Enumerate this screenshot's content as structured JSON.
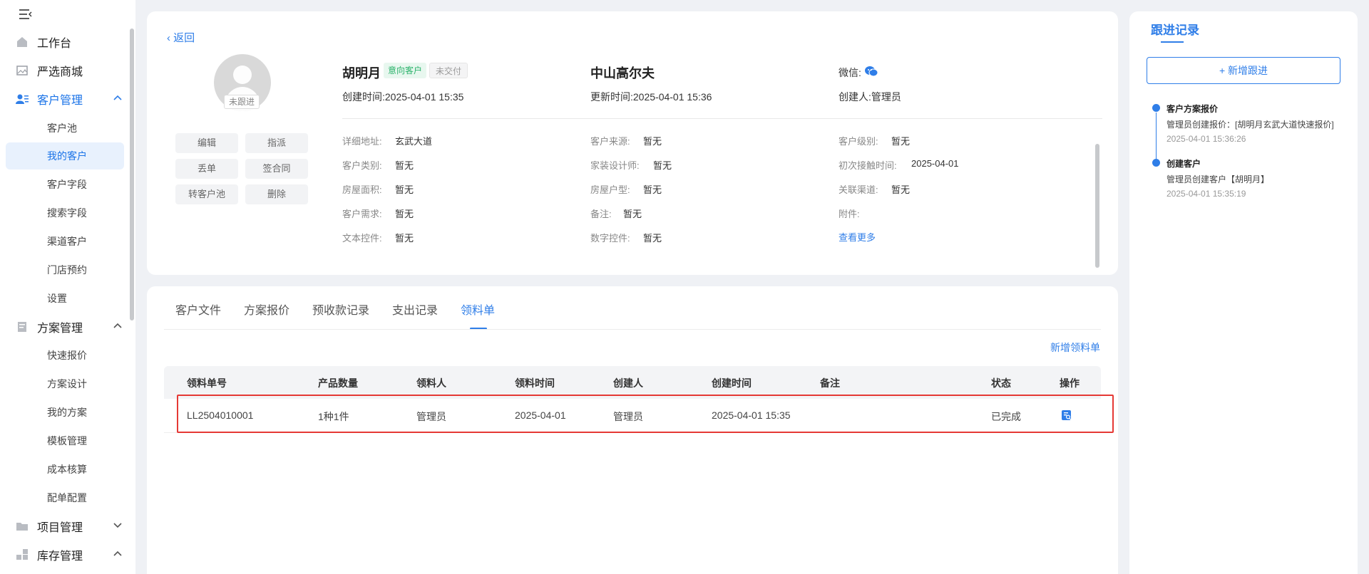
{
  "sidebar": {
    "menu": [
      {
        "label": "工作台",
        "icon": "home-icon"
      },
      {
        "label": "严选商城",
        "icon": "image-icon"
      },
      {
        "label": "客户管理",
        "icon": "user-card-icon"
      },
      {
        "label": "方案管理",
        "icon": "document-icon"
      },
      {
        "label": "项目管理",
        "icon": "folder-icon"
      },
      {
        "label": "库存管理",
        "icon": "grid-icon"
      }
    ],
    "customer_sub": [
      "客户池",
      "我的客户",
      "客户字段",
      "搜索字段",
      "渠道客户",
      "门店预约",
      "设置"
    ],
    "plan_sub": [
      "快速报价",
      "方案设计",
      "我的方案",
      "模板管理",
      "成本核算",
      "配单配置"
    ]
  },
  "header": {
    "back": "返回",
    "avatar_tag": "未跟进",
    "actions": [
      "编辑",
      "指派",
      "丢单",
      "签合同",
      "转客户池",
      "删除"
    ],
    "name": "胡明月",
    "tag_intent": "意向客户",
    "tag_delivery": "未交付",
    "created_label": "创建时间:",
    "created_value": "2025-04-01 15:35",
    "company": "中山高尔夫",
    "updated_label": "更新时间:",
    "updated_value": "2025-04-01 15:36",
    "wechat_label": "微信:",
    "creator_label": "创建人:",
    "creator_value": "管理员"
  },
  "info": [
    [
      {
        "label": "详细地址:",
        "value": "玄武大道"
      },
      {
        "label": "客户来源:",
        "value": "暂无"
      },
      {
        "label": "客户级别:",
        "value": "暂无"
      }
    ],
    [
      {
        "label": "客户类别:",
        "value": "暂无"
      },
      {
        "label": "家装设计师:",
        "value": "暂无"
      },
      {
        "label": "初次接触时间:",
        "value": "2025-04-01"
      }
    ],
    [
      {
        "label": "房屋面积:",
        "value": "暂无"
      },
      {
        "label": "房屋户型:",
        "value": "暂无"
      },
      {
        "label": "关联渠道:",
        "value": "暂无"
      }
    ],
    [
      {
        "label": "客户需求:",
        "value": "暂无"
      },
      {
        "label": "备注:",
        "value": "暂无"
      },
      {
        "label": "附件:",
        "value": ""
      }
    ],
    [
      {
        "label": "文本控件:",
        "value": "暂无"
      },
      {
        "label": "数字控件:",
        "value": "暂无"
      }
    ]
  ],
  "see_more": "查看更多",
  "tabs": [
    "客户文件",
    "方案报价",
    "预收款记录",
    "支出记录",
    "领料单"
  ],
  "new_requisition": "新增领料单",
  "table": {
    "headers": [
      "领料单号",
      "产品数量",
      "领料人",
      "领料时间",
      "创建人",
      "创建时间",
      "备注",
      "状态",
      "操作"
    ],
    "rows": [
      [
        "LL2504010001",
        "1种1件",
        "管理员",
        "2025-04-01",
        "管理员",
        "2025-04-01 15:35",
        "",
        "已完成"
      ]
    ]
  },
  "followup": {
    "title": "跟进记录",
    "add": "+ 新增跟进",
    "items": [
      {
        "title": "客户方案报价",
        "desc": "管理员创建报价：[胡明月玄武大道快速报价]",
        "time": "2025-04-01 15:36:26"
      },
      {
        "title": "创建客户",
        "desc": "管理员创建客户【胡明月】",
        "time": "2025-04-01 15:35:19"
      }
    ]
  },
  "colors": {
    "accent": "#2f7ee8",
    "highlight": "#e53935",
    "success": "#2bb36b"
  }
}
